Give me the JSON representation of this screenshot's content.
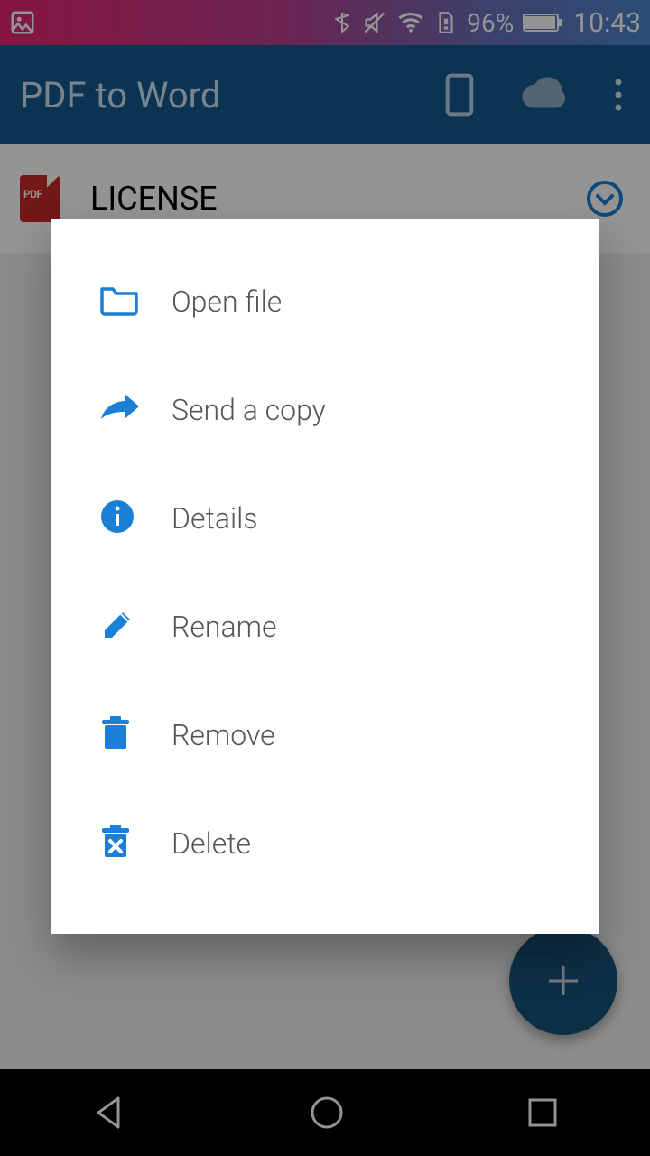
{
  "status": {
    "battery_pct": "96%",
    "time": "10:43"
  },
  "appbar": {
    "title": "PDF to Word"
  },
  "list": {
    "file_name": "LICENSE",
    "file_badge": "PDF"
  },
  "menu": {
    "open": "Open file",
    "send": "Send a copy",
    "details": "Details",
    "rename": "Rename",
    "remove": "Remove",
    "delete": "Delete"
  },
  "colors": {
    "primary": "#135a8f",
    "accent_blue": "#1a7fd6",
    "fab": "#19547a"
  }
}
